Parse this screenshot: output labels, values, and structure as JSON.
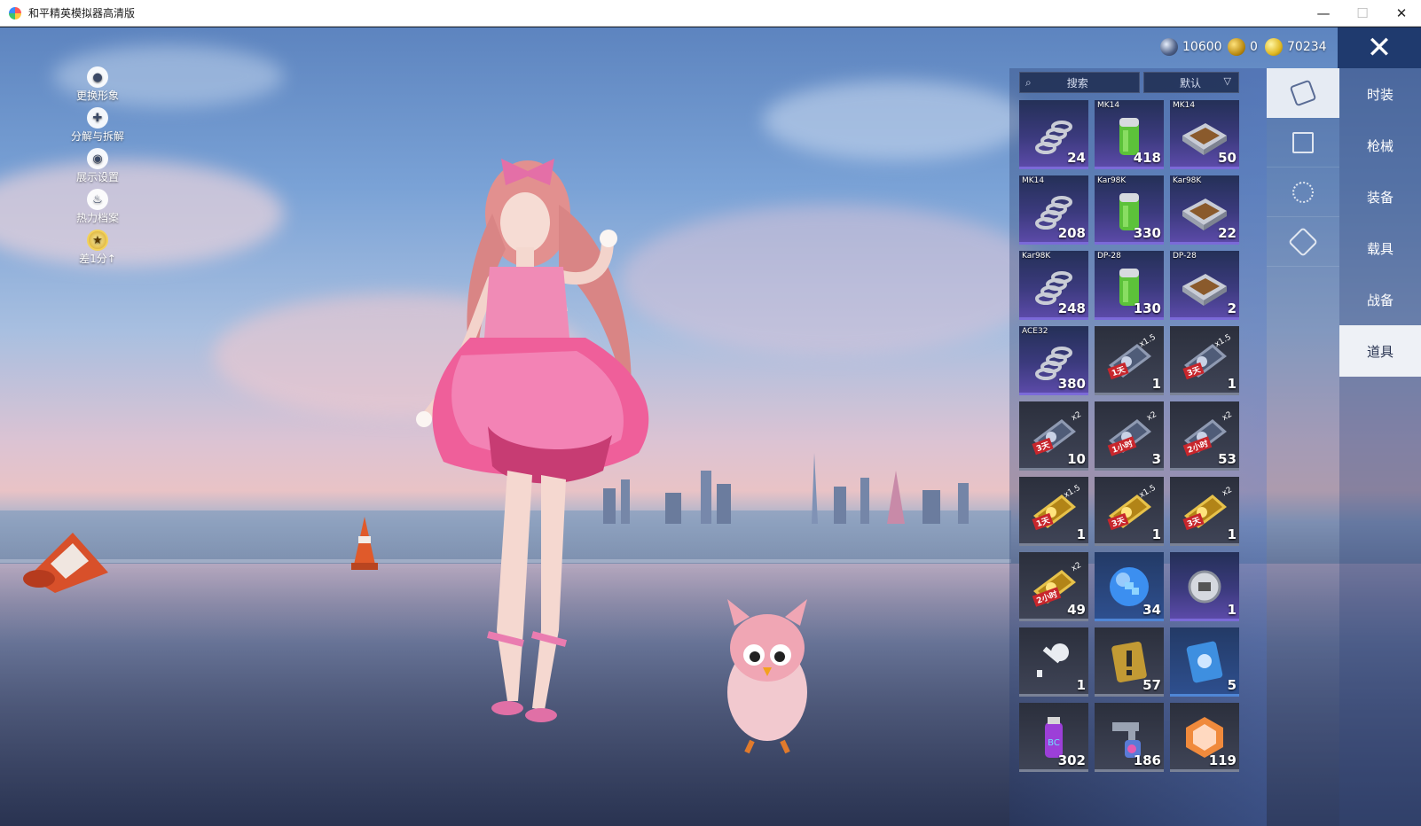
{
  "window": {
    "title": "和平精英模拟器高清版",
    "minimize": "—",
    "maximize": "☐",
    "close": "✕"
  },
  "currency": [
    {
      "icon": "silver-coin-icon",
      "value": "10600"
    },
    {
      "icon": "gold-token-icon",
      "value": "0"
    },
    {
      "icon": "coupon-coin-icon",
      "value": "70234"
    }
  ],
  "side_menu": [
    {
      "icon": "person-icon",
      "label": "更换形象"
    },
    {
      "icon": "puzzle-icon",
      "label": "分解与拆解"
    },
    {
      "icon": "eye-icon",
      "label": "展示设置"
    },
    {
      "icon": "flame-icon",
      "label": "热力档案"
    },
    {
      "icon": "rank-badge-icon",
      "label": "差1分↑"
    }
  ],
  "inventory": {
    "search_placeholder": "搜索",
    "sort_label": "默认",
    "items": [
      {
        "label": "",
        "count": "24",
        "art": "spring",
        "tier": "purple"
      },
      {
        "label": "MK14",
        "count": "418",
        "art": "canister",
        "tier": "purple"
      },
      {
        "label": "MK14",
        "count": "50",
        "art": "crate",
        "tier": "purple"
      },
      {
        "label": "MK14",
        "count": "208",
        "art": "spring",
        "tier": "purple"
      },
      {
        "label": "Kar98K",
        "count": "330",
        "art": "canister",
        "tier": "purple"
      },
      {
        "label": "Kar98K",
        "count": "22",
        "art": "crate",
        "tier": "purple"
      },
      {
        "label": "Kar98K",
        "count": "248",
        "art": "spring",
        "tier": "purple"
      },
      {
        "label": "DP-28",
        "count": "130",
        "art": "canister",
        "tier": "purple"
      },
      {
        "label": "DP-28",
        "count": "2",
        "art": "crate",
        "tier": "purple"
      },
      {
        "label": "ACE32",
        "count": "380",
        "art": "spring",
        "tier": "purple"
      },
      {
        "label": "",
        "count": "1",
        "art": "card-xp",
        "tier": "gray",
        "badge": "1天",
        "mult": "x1.5"
      },
      {
        "label": "",
        "count": "1",
        "art": "card-xp",
        "tier": "gray",
        "badge": "3天",
        "mult": "x1.5"
      },
      {
        "label": "",
        "count": "10",
        "art": "card-xp",
        "tier": "gray",
        "badge": "3天",
        "mult": "x2"
      },
      {
        "label": "",
        "count": "3",
        "art": "card-xp",
        "tier": "gray",
        "badge": "1小时",
        "mult": "x2"
      },
      {
        "label": "",
        "count": "53",
        "art": "card-xp",
        "tier": "gray",
        "badge": "2小时",
        "mult": "x2"
      },
      {
        "label": "",
        "count": "1",
        "art": "card-gold",
        "tier": "gray",
        "badge": "1天",
        "mult": "x1.5"
      },
      {
        "label": "",
        "count": "1",
        "art": "card-gold",
        "tier": "gray",
        "badge": "3天",
        "mult": "x1.5"
      },
      {
        "label": "",
        "count": "1",
        "art": "card-gold",
        "tier": "gray",
        "badge": "3天",
        "mult": "x2"
      },
      {
        "label": "",
        "count": "49",
        "art": "card-gold",
        "tier": "gray",
        "badge": "2小时",
        "mult": "x2"
      },
      {
        "label": "",
        "count": "34",
        "art": "orb",
        "tier": "blue"
      },
      {
        "label": "",
        "count": "1",
        "art": "medal",
        "tier": "purple"
      },
      {
        "label": "",
        "count": "1",
        "art": "key",
        "tier": "gray"
      },
      {
        "label": "",
        "count": "57",
        "art": "warning-card",
        "tier": "gray"
      },
      {
        "label": "",
        "count": "5",
        "art": "blue-card",
        "tier": "blue"
      },
      {
        "label": "",
        "count": "302",
        "art": "spray-can",
        "tier": "gray"
      },
      {
        "label": "",
        "count": "186",
        "art": "spray-gun",
        "tier": "gray"
      },
      {
        "label": "",
        "count": "119",
        "art": "emblem",
        "tier": "gray"
      }
    ]
  },
  "icon_tabs": [
    {
      "icon": "card-tab-icon",
      "active": true
    },
    {
      "icon": "chest-tab-icon",
      "active": false
    },
    {
      "icon": "firework-tab-icon",
      "active": false
    },
    {
      "icon": "ticket-tab-icon",
      "active": false
    }
  ],
  "categories": [
    {
      "label": "时装",
      "active": false
    },
    {
      "label": "枪械",
      "active": false
    },
    {
      "label": "装备",
      "active": false
    },
    {
      "label": "载具",
      "active": false
    },
    {
      "label": "战备",
      "active": false
    },
    {
      "label": "道具",
      "active": true
    }
  ],
  "close_button": "✕"
}
